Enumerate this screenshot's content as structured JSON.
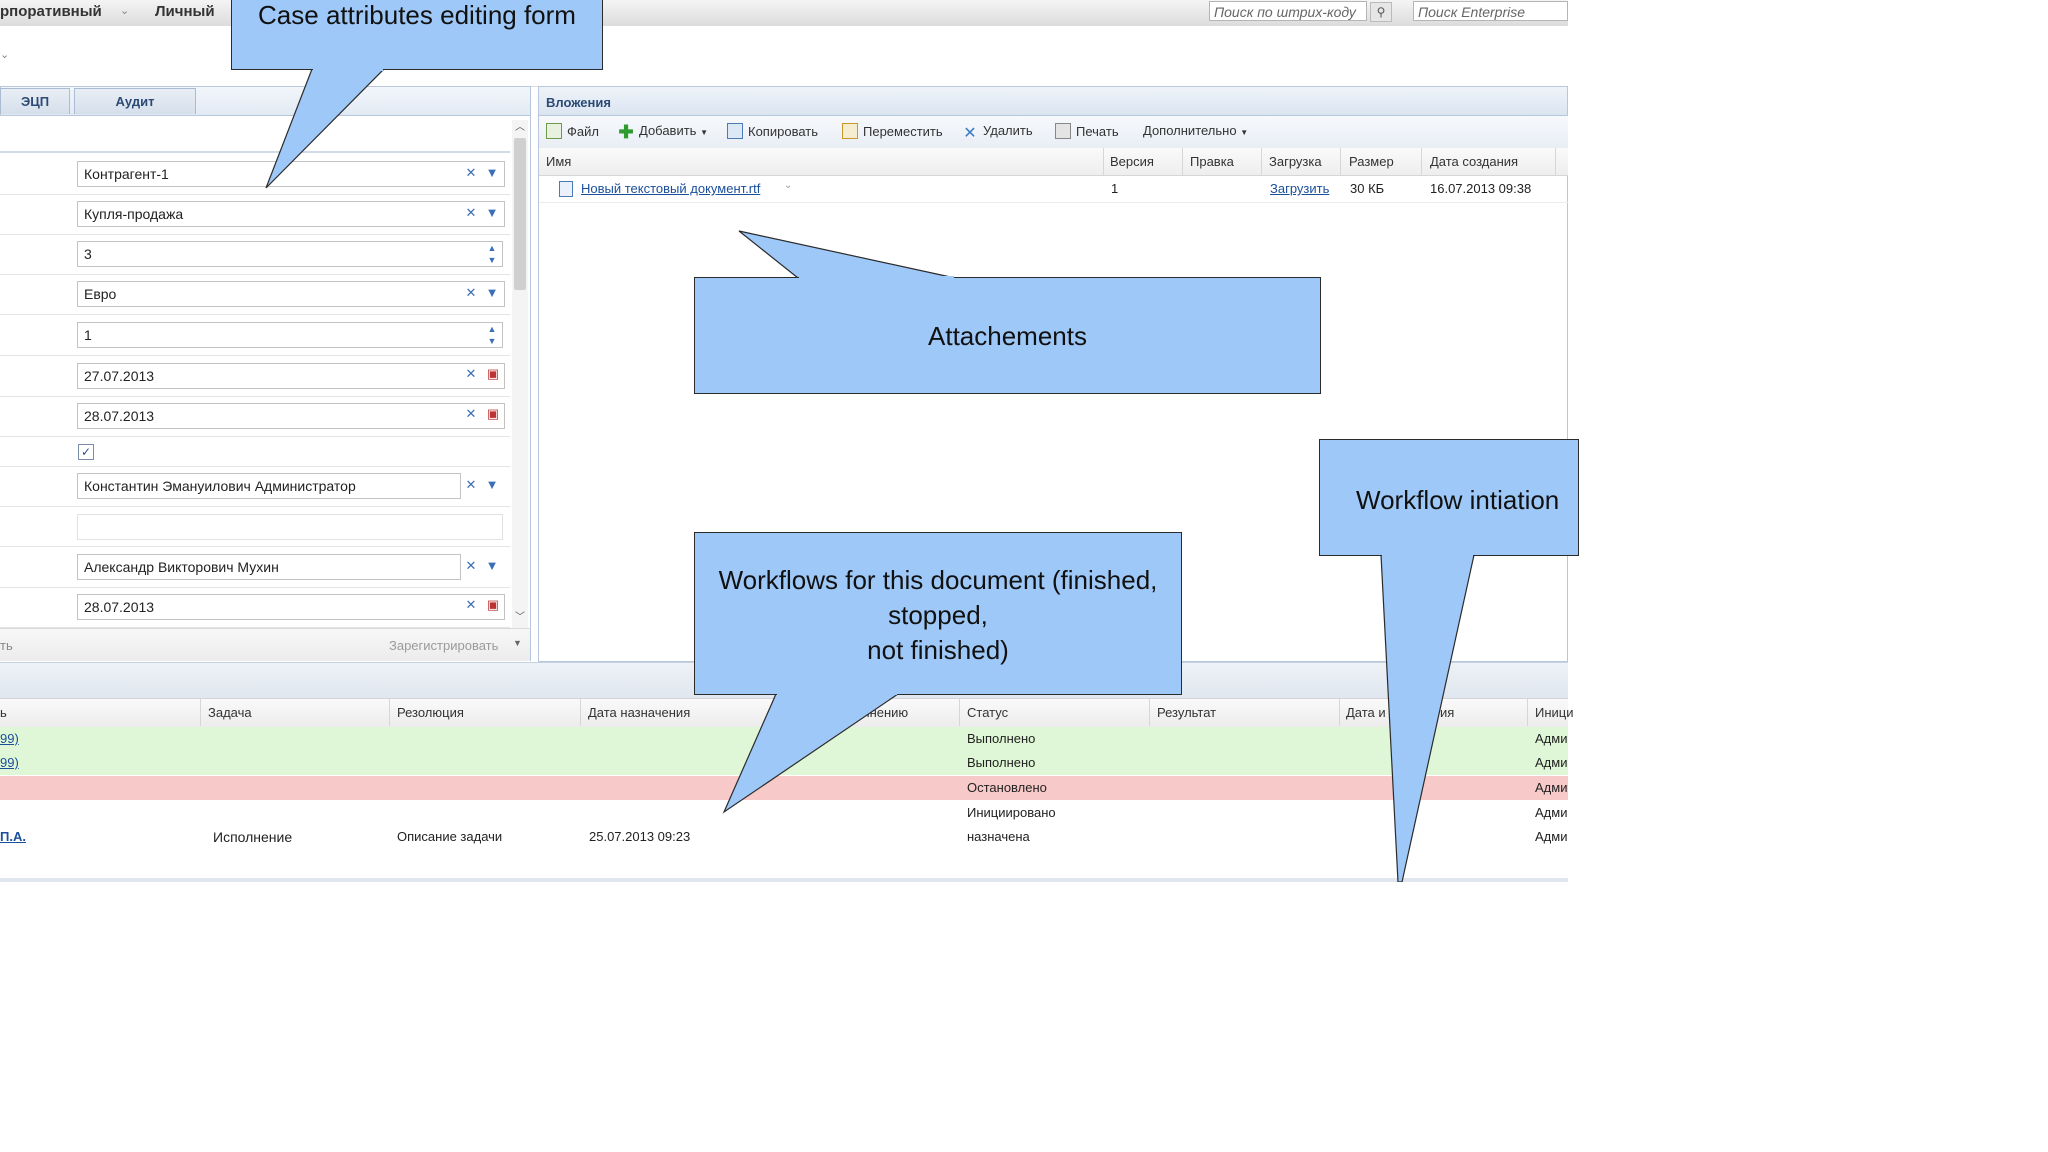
{
  "topbar": {
    "tab_corporate": "рпоративный",
    "tab_personal": "Личный",
    "search_barcode_placeholder": "Поиск по штрих-коду",
    "search_enterprise_placeholder": "Поиск  Enterprise"
  },
  "left_panel": {
    "tab_ecp": "ЭЦП",
    "tab_audit": "Аудит",
    "fields": {
      "counterparty": "Контрагент-1",
      "contract_type": "Купля-продажа",
      "number": "3",
      "currency": "Евро",
      "quantity": "1",
      "date_start": "27.07.2013",
      "date_end": "28.07.2013",
      "checkbox_checked": true,
      "responsible": "Константин Эмануилович Администратор",
      "empty_field": "",
      "performer": "Александр Викторович Мухин",
      "date_due": "28.07.2013"
    },
    "footer_left": "ть",
    "register_label": "Зарегистрировать"
  },
  "attachments": {
    "title": "Вложения",
    "toolbar": {
      "file": "Файл",
      "add": "Добавить",
      "copy": "Копировать",
      "move": "Переместить",
      "delete": "Удалить",
      "print": "Печать",
      "more": "Дополнительно"
    },
    "columns": [
      "Имя",
      "Версия",
      "Правка",
      "Загрузка",
      "Размер",
      "Дата создания"
    ],
    "rows": [
      {
        "name": "Новый текстовый документ.rtf",
        "version": "1",
        "edit": "",
        "download": "Загрузить",
        "size": "30 КБ",
        "created": "16.07.2013 09:38"
      }
    ]
  },
  "tasks": {
    "columns": {
      "c0": "ь",
      "task": "Задача",
      "resolution": "Резолюция",
      "assigned_date": "Дата назначения",
      "c_hidden": "лнению",
      "status": "Статус",
      "result": "Результат",
      "date_partial": "Дата и",
      "date_partial2": "ия",
      "initiator": "Иници"
    },
    "rows": [
      {
        "c0": "99)",
        "task": "",
        "resolution": "",
        "assigned": "",
        "status": "Выполнено",
        "initiator": "Адми",
        "color": "#dff7d6"
      },
      {
        "c0": "99)",
        "task": "",
        "resolution": "",
        "assigned": "",
        "status": "Выполнено",
        "initiator": "Адми",
        "color": "#dff7d6"
      },
      {
        "c0": "",
        "task": "",
        "resolution": "",
        "assigned": "",
        "status": "Остановлено",
        "initiator": "Адми",
        "color": "#f8c9c9"
      },
      {
        "c0": "",
        "task": "",
        "resolution": "",
        "assigned": "",
        "status": "Инициировано",
        "initiator": "Адми",
        "color": "#ffffff"
      },
      {
        "c0": "П.А.",
        "task": "Исполнение",
        "resolution": "Описание задачи",
        "assigned": "25.07.2013 09:23",
        "status": "назначена",
        "initiator": "Адми",
        "color": "#ffffff"
      }
    ]
  },
  "callouts": {
    "case_form": "Case attributes editing form",
    "attachments": "Attachements",
    "workflows_line1": "Workflows for this document (finished,",
    "workflows_line2": "stopped,",
    "workflows_line3": "not finished)",
    "workflow_init": "Workflow intiation"
  },
  "colors": {
    "callout_fill": "#9ec8f8",
    "done_row": "#dff7d6",
    "stopped_row": "#f8c9c9",
    "accent": "#1a4f9c"
  }
}
